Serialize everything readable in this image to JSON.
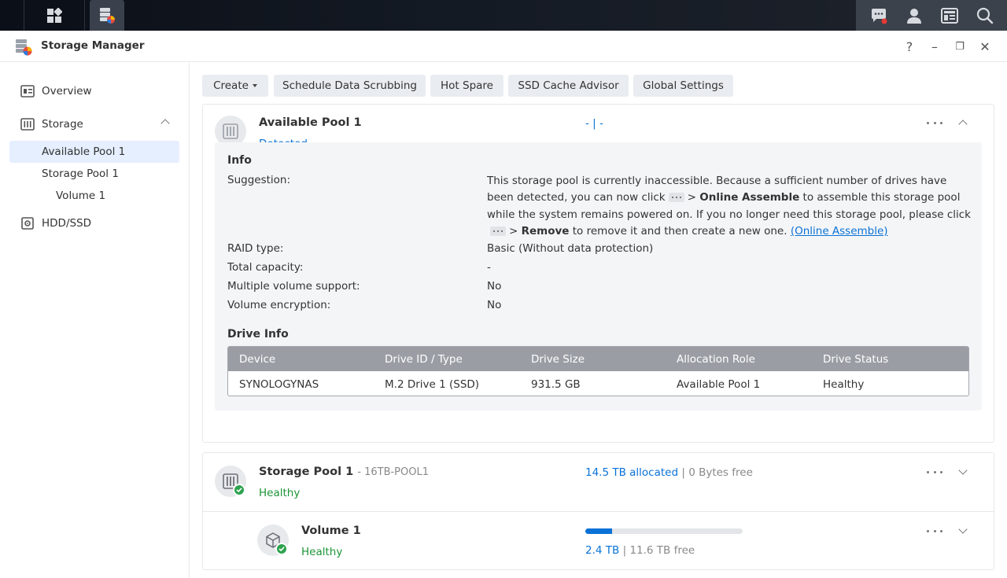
{
  "window": {
    "title": "Storage Manager",
    "controls": [
      "?",
      "–",
      "❐",
      "✕"
    ]
  },
  "taskbar": {
    "icons": [
      "main-menu-icon",
      "storage-manager-icon",
      "notification-icon",
      "user-icon",
      "widgets-icon",
      "search-icon"
    ]
  },
  "sidebar": {
    "items": [
      {
        "label": "Overview",
        "icon": "overview-icon"
      },
      {
        "label": "Storage",
        "icon": "storage-icon"
      },
      {
        "label": "Available Pool 1"
      },
      {
        "label": "Storage Pool 1"
      },
      {
        "label": "Volume 1"
      },
      {
        "label": "HDD/SSD",
        "icon": "hdd-icon"
      }
    ]
  },
  "toolbar": {
    "create": "Create",
    "scrubbing": "Schedule Data Scrubbing",
    "hot_spare": "Hot Spare",
    "ssd_cache": "SSD Cache Advisor",
    "global_settings": "Global Settings"
  },
  "available_pool": {
    "title": "Available Pool 1",
    "status": "Detected",
    "usage": "- | -",
    "info_title": "Info",
    "suggestion_label": "Suggestion:",
    "suggestion": {
      "part1": "This storage pool is currently inaccessible. Because a sufficient number of drives have been detected, you can now click",
      "gt1": ">",
      "bold1": "Online Assemble",
      "part2": "to assemble this storage pool while the system remains powered on. If you no longer need this storage pool, please click",
      "gt2": ">",
      "bold2": "Remove",
      "part3": "to remove it and then create a new one.",
      "link": "(Online Assemble)"
    },
    "rows": [
      {
        "label": "RAID type:",
        "value": "Basic (Without data protection)"
      },
      {
        "label": "Total capacity:",
        "value": "-"
      },
      {
        "label": "Multiple volume support:",
        "value": "No"
      },
      {
        "label": "Volume encryption:",
        "value": "No"
      }
    ],
    "drive_info_title": "Drive Info",
    "drive_table": {
      "columns": [
        "Device",
        "Drive ID / Type",
        "Drive Size",
        "Allocation Role",
        "Drive Status"
      ],
      "rows": [
        [
          "SYNOLOGYNAS",
          "M.2 Drive 1 (SSD)",
          "931.5 GB",
          "Available Pool 1",
          "Healthy"
        ]
      ]
    }
  },
  "storage_pool": {
    "title": "Storage Pool 1",
    "subtitle": "- 16TB-POOL1",
    "status": "Healthy",
    "allocated": "14.5 TB allocated",
    "separator": "|",
    "free": "0 Bytes free"
  },
  "volume": {
    "title": "Volume 1",
    "status": "Healthy",
    "used": "2.4 TB",
    "separator": "|",
    "free": "11.6 TB free",
    "usage_fraction": 0.17
  },
  "colors": {
    "accent": "#0a72d6",
    "healthy": "#1d9436",
    "selected_bg": "#e5efff"
  }
}
